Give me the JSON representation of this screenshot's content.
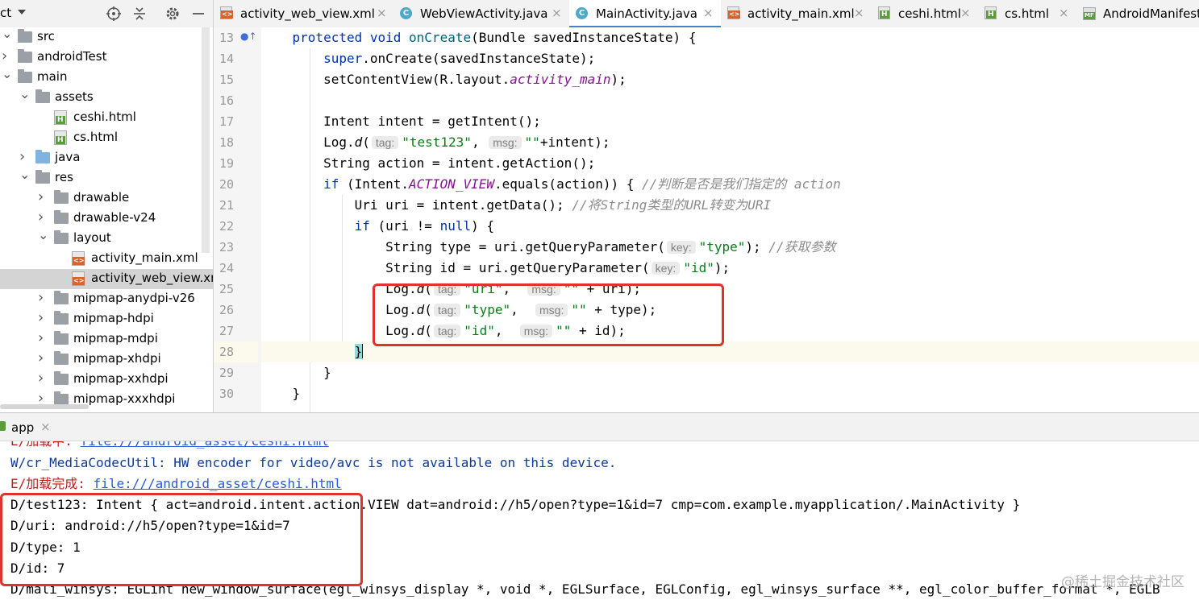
{
  "project_panel": {
    "title": "ct",
    "tree": [
      {
        "label": "src",
        "depth": 0,
        "arrow": "down",
        "icon": "folder"
      },
      {
        "label": "androidTest",
        "depth": 0,
        "arrow": "right",
        "icon": "folder"
      },
      {
        "label": "main",
        "depth": 0,
        "arrow": "down",
        "icon": "folder"
      },
      {
        "label": "assets",
        "depth": 1,
        "arrow": "down",
        "icon": "folder"
      },
      {
        "label": "ceshi.html",
        "depth": 2,
        "arrow": "",
        "icon": "html"
      },
      {
        "label": "cs.html",
        "depth": 2,
        "arrow": "",
        "icon": "html"
      },
      {
        "label": "java",
        "depth": 1,
        "arrow": "right",
        "icon": "folder-blue"
      },
      {
        "label": "res",
        "depth": 1,
        "arrow": "down",
        "icon": "folder"
      },
      {
        "label": "drawable",
        "depth": 2,
        "arrow": "right",
        "icon": "folder"
      },
      {
        "label": "drawable-v24",
        "depth": 2,
        "arrow": "right",
        "icon": "folder"
      },
      {
        "label": "layout",
        "depth": 2,
        "arrow": "down",
        "icon": "folder"
      },
      {
        "label": "activity_main.xml",
        "depth": 3,
        "arrow": "",
        "icon": "xml"
      },
      {
        "label": "activity_web_view.xml",
        "depth": 3,
        "arrow": "",
        "icon": "xml",
        "selected": true
      },
      {
        "label": "mipmap-anydpi-v26",
        "depth": 2,
        "arrow": "right",
        "icon": "folder"
      },
      {
        "label": "mipmap-hdpi",
        "depth": 2,
        "arrow": "right",
        "icon": "folder"
      },
      {
        "label": "mipmap-mdpi",
        "depth": 2,
        "arrow": "right",
        "icon": "folder"
      },
      {
        "label": "mipmap-xhdpi",
        "depth": 2,
        "arrow": "right",
        "icon": "folder"
      },
      {
        "label": "mipmap-xxhdpi",
        "depth": 2,
        "arrow": "right",
        "icon": "folder"
      },
      {
        "label": "mipmap-xxxhdpi",
        "depth": 2,
        "arrow": "right",
        "icon": "folder"
      }
    ]
  },
  "tabs": [
    {
      "label": "activity_web_view.xml",
      "icon": "xml"
    },
    {
      "label": "WebViewActivity.java",
      "icon": "class"
    },
    {
      "label": "MainActivity.java",
      "icon": "class",
      "active": true
    },
    {
      "label": "activity_main.xml",
      "icon": "xml"
    },
    {
      "label": "ceshi.html",
      "icon": "html"
    },
    {
      "label": "cs.html",
      "icon": "html"
    },
    {
      "label": "AndroidManifest",
      "icon": "manifest"
    }
  ],
  "editor": {
    "line_numbers": [
      "13",
      "14",
      "15",
      "16",
      "17",
      "18",
      "19",
      "20",
      "21",
      "22",
      "23",
      "24",
      "25",
      "26",
      "27",
      "28",
      "29",
      "30"
    ],
    "current_line": "28",
    "hints": {
      "tag": "tag:",
      "msg": "msg:",
      "key": "key:"
    },
    "comments": {
      "l20": "//判断是否是我们指定的 action",
      "l21": "//将String类型的URL转变为URI",
      "l23": "//获取参数"
    }
  },
  "run": {
    "tab_label": "app",
    "log": [
      {
        "level": "E",
        "text": "E/加载中: ",
        "link": "file:///android_asset/ceshi.html"
      },
      {
        "level": "W",
        "text": "W/cr_MediaCodecUtil: HW encoder for video/avc is not available on this device."
      },
      {
        "level": "E",
        "text": "E/加载完成: ",
        "link": "file:///android_asset/ceshi.html"
      },
      {
        "level": "D",
        "text": "D/test123: Intent { act=android.intent.action.VIEW dat=android://h5/open?type=1&id=7 cmp=com.example.myapplication/.MainActivity }"
      },
      {
        "level": "D",
        "text": "D/uri: android://h5/open?type=1&id=7"
      },
      {
        "level": "D",
        "text": "D/type: 1"
      },
      {
        "level": "D",
        "text": "D/id: 7"
      },
      {
        "level": "D",
        "text": "D/mali_winsys: EGLint new_window_surface(egl_winsys_display *, void *, EGLSurface, EGLConfig, egl_winsys_surface **, egl_color_buffer_format *, EGLB"
      }
    ]
  },
  "watermark": "@稀土掘金技术社区",
  "colors": {
    "accent": "#4083c9",
    "highlight_box": "#e0322e",
    "keyword": "#0033b3",
    "string": "#067d17",
    "comment": "#8c8c8c"
  }
}
